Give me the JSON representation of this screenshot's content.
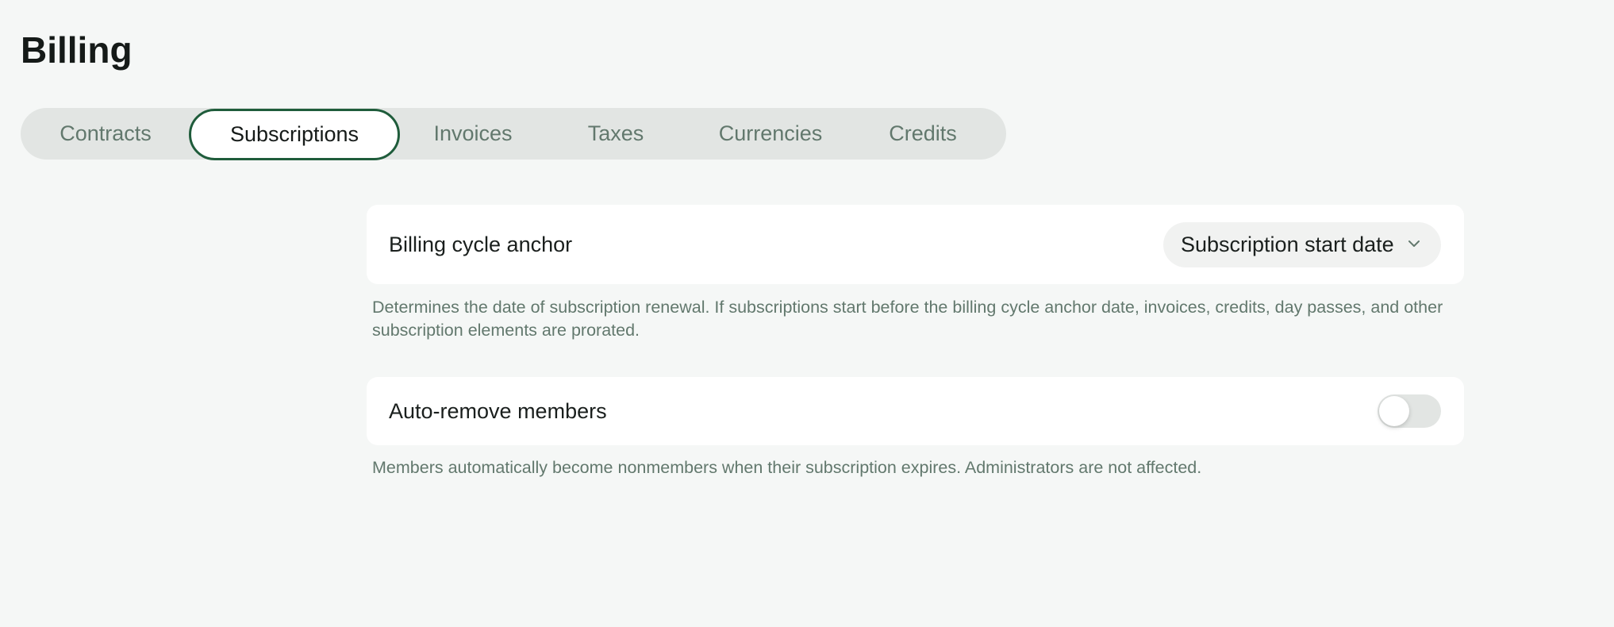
{
  "page": {
    "title": "Billing"
  },
  "tabs": [
    {
      "label": "Contracts",
      "active": false
    },
    {
      "label": "Subscriptions",
      "active": true
    },
    {
      "label": "Invoices",
      "active": false
    },
    {
      "label": "Taxes",
      "active": false
    },
    {
      "label": "Currencies",
      "active": false
    },
    {
      "label": "Credits",
      "active": false
    }
  ],
  "settings": {
    "billing_cycle_anchor": {
      "label": "Billing cycle anchor",
      "selected": "Subscription start date",
      "icon": "chevron-down-icon",
      "description": "Determines the date of subscription renewal. If subscriptions start before the billing cycle anchor date, invoices, credits, day passes, and other subscription elements are prorated."
    },
    "auto_remove_members": {
      "label": "Auto-remove members",
      "enabled": false,
      "description": "Members automatically become nonmembers when their subscription expires. Administrators are not affected."
    }
  },
  "colors": {
    "accent": "#1f5c3b",
    "muted_text": "#62786d",
    "tabbar_bg": "#e2e5e3",
    "page_bg": "#f5f7f6"
  }
}
